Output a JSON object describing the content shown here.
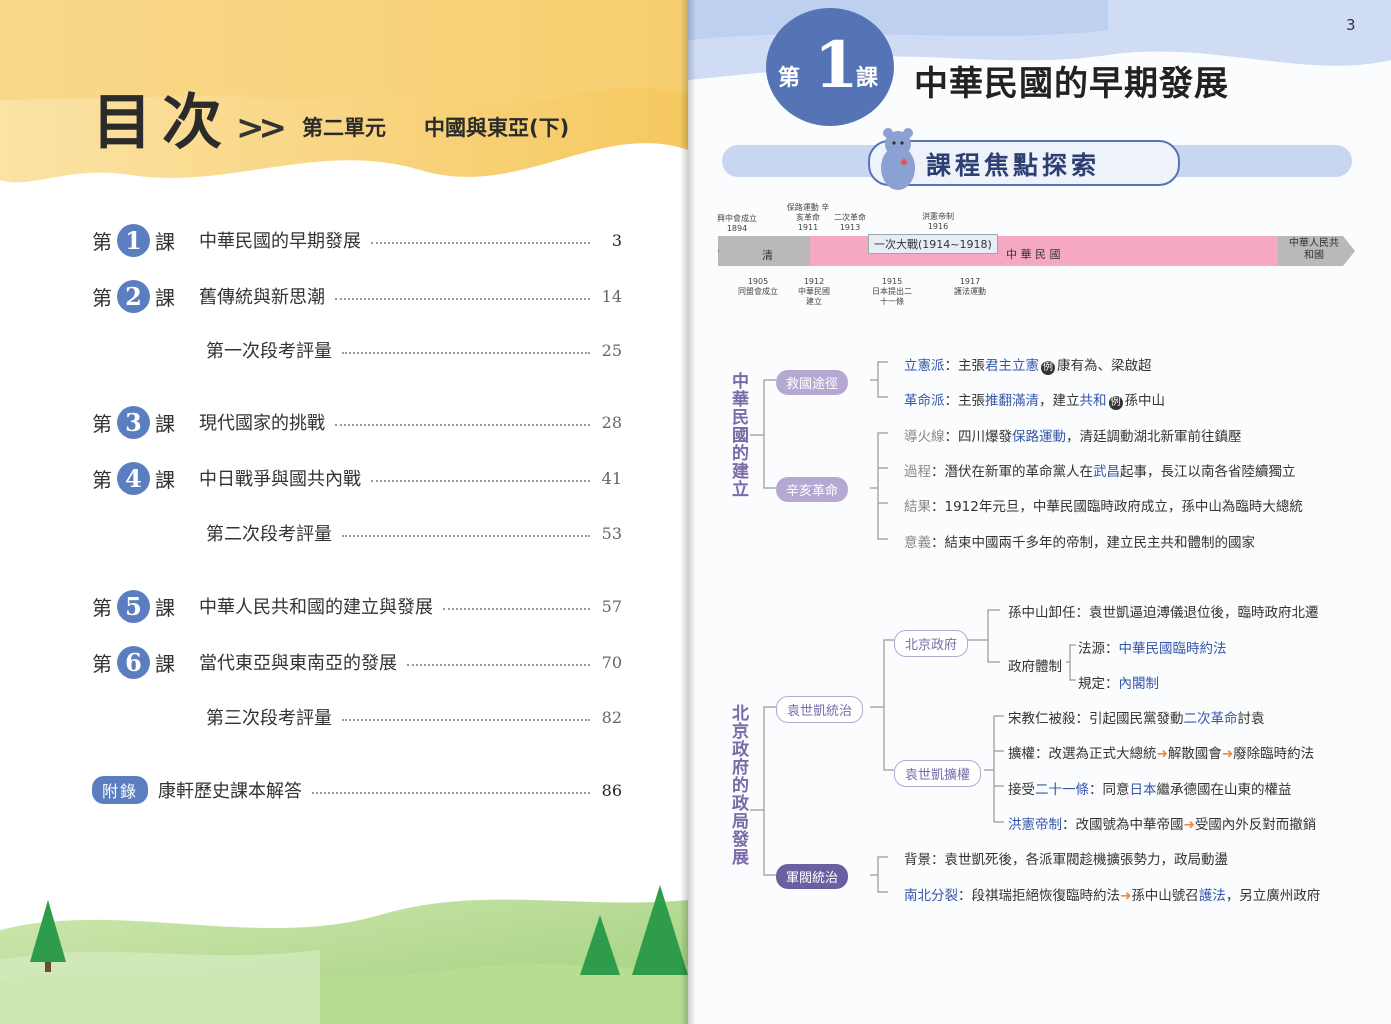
{
  "left_page": {
    "title": "目次",
    "arrow": ">>",
    "unit_label": "第二單元",
    "unit_name": "中國與東亞(下)",
    "prefix": "第",
    "suffix": "課",
    "lessons": [
      {
        "num": "1",
        "title": "中華民國的早期發展",
        "page": "3"
      },
      {
        "num": "2",
        "title": "舊傳統與新思潮",
        "page": "14"
      },
      {
        "num": "3",
        "title": "現代國家的挑戰",
        "page": "28"
      },
      {
        "num": "4",
        "title": "中日戰爭與國共內戰",
        "page": "41"
      },
      {
        "num": "5",
        "title": "中華人民共和國的建立與發展",
        "page": "57"
      },
      {
        "num": "6",
        "title": "當代東亞與東南亞的發展",
        "page": "70"
      }
    ],
    "exams": [
      {
        "title": "第一次段考評量",
        "page": "25"
      },
      {
        "title": "第二次段考評量",
        "page": "53"
      },
      {
        "title": "第三次段考評量",
        "page": "82"
      }
    ],
    "appendix": {
      "tag": "附錄",
      "title": "康軒歷史課本解答",
      "page": "86"
    }
  },
  "right_page": {
    "page_number": "3",
    "lesson_di": "第",
    "lesson_num": "1",
    "lesson_ke": "課",
    "lesson_title": "中華民國的早期發展",
    "focus": "課程焦點探索",
    "timeline": {
      "qing": "清",
      "roc": "中 華 民 國",
      "prc": "中華人民共和國",
      "ww1": "一次大戰(1914~1918)",
      "above": [
        {
          "label": "興中會成立",
          "year": "1894"
        },
        {
          "label": "保路運動 辛亥革命",
          "year": "1911"
        },
        {
          "label": "二次革命",
          "year": "1913"
        },
        {
          "label": "洪憲帝制",
          "year": "1916"
        }
      ],
      "below": [
        {
          "year": "1905",
          "label": "同盟會成立"
        },
        {
          "year": "1912",
          "label": "中華民國建立"
        },
        {
          "year": "1915",
          "label": "日本提出二十一條"
        },
        {
          "year": "1917",
          "label": "護法運動"
        }
      ]
    },
    "section1": {
      "vtitle": "中華民國的建立",
      "node_a": "救國途徑",
      "a1_key": "立憲派",
      "a1_pre": "：主張",
      "a1_hl": "君主立憲",
      "a1_ex": "例",
      "a1_rest": "康有為、梁啟超",
      "a2_key": "革命派",
      "a2_pre": "：主張",
      "a2_hl": "推翻滿清",
      "a2_mid": "，建立",
      "a2_hl2": "共和",
      "a2_ex": "例",
      "a2_rest": "孫中山",
      "node_b": "辛亥革命",
      "b1_key": "導火線",
      "b1_pre": "：四川爆發",
      "b1_hl": "保路運動",
      "b1_rest": "，清廷調動湖北新軍前往鎮壓",
      "b2_key": "過程",
      "b2_pre": "：潛伏在新軍的革命黨人在",
      "b2_hl": "武昌",
      "b2_rest": "起事，長江以南各省陸續獨立",
      "b3_key": "結果",
      "b3_rest": "：1912年元旦，中華民國臨時政府成立，孫中山為臨時大總統",
      "b4_key": "意義",
      "b4_rest": "：結束中國兩千多年的帝制，建立民主共和體制的國家"
    },
    "section2": {
      "vtitle": "北京政府的政局發展",
      "node_yuan": "袁世凱統治",
      "node_bj": "北京政府",
      "bj1": "孫中山卸任：袁世凱逼迫溥儀退位後，臨時政府北遷",
      "bj2_key": "政府體制",
      "bj2a_pre": "法源：",
      "bj2a_hl": "中華民國臨時約法",
      "bj2b_pre": "規定：",
      "bj2b_hl": "內閣制",
      "node_kq": "袁世凱擴權",
      "kq1_pre": "宋教仁被殺：引起國民黨發動",
      "kq1_hl": "二次革命",
      "kq1_rest": "討袁",
      "kq2_pre": "擴權：改選為正式大總統",
      "kq2_mid": "解散國會",
      "kq2_rest": "廢除臨時約法",
      "kq3_pre": "接受",
      "kq3_hl": "二十一條",
      "kq3_mid": "：同意",
      "kq3_hl2": "日本",
      "kq3_rest": "繼承德國在山東的權益",
      "kq4_hl": "洪憲帝制",
      "kq4_mid": "：改國號為中華帝國",
      "kq4_rest": "受國內外反對而撤銷",
      "node_jf": "軍閥統治",
      "jf1": "背景：袁世凱死後，各派軍閥趁機擴張勢力，政局動盪",
      "jf2_hl": "南北分裂",
      "jf2_pre": "：段祺瑞拒絕恢復臨時約法",
      "jf2_mid": "孫中山號召",
      "jf2_hl2": "護法",
      "jf2_rest": "，另立廣州政府"
    }
  },
  "colors": {
    "accent": "#5574b6",
    "node": "#b5a9d3",
    "highlight": "#3556a8",
    "arrow": "#f08a3a"
  }
}
